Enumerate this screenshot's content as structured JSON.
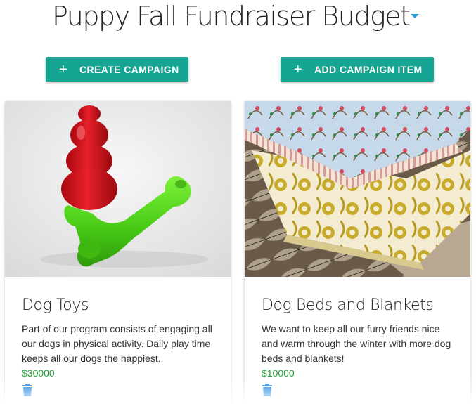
{
  "header": {
    "title": "Puppy Fall Fundraiser Budget",
    "dropdown_icon": "caret-down-icon",
    "accent_color": "#1e9fd6"
  },
  "actions": {
    "create_label": "CREATE CAMPAIGN",
    "add_label": "ADD CAMPAIGN ITEM",
    "plus_glyph": "+",
    "button_color": "#17a593"
  },
  "cards": [
    {
      "image": "dog-toys-photo",
      "title": "Dog Toys",
      "description": "Part of our program consists of engaging all our dogs in physical activity. Daily play time keeps all our dogs the happiest.",
      "amount": "$30000",
      "delete_icon": "trash-icon"
    },
    {
      "image": "dog-beds-photo",
      "title": "Dog Beds and Blankets",
      "description": "We want to keep all our furry friends nice and warm through the winter with more dog beds and blankets!",
      "amount": "$10000",
      "delete_icon": "trash-icon"
    }
  ],
  "colors": {
    "amount": "#27a03a",
    "trash": "#1e88e5"
  }
}
